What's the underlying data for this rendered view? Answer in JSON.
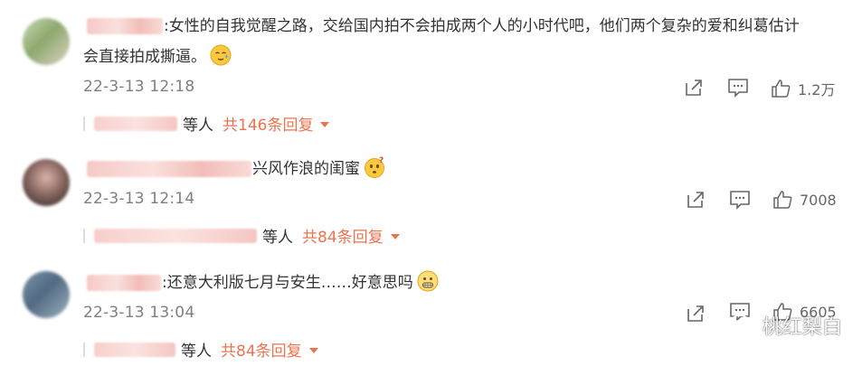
{
  "comments": [
    {
      "text_line1": ":女性的自我觉醒之路，交给国内拍不会拍成两个人的小时代吧，他们两个复杂的爱和纠葛估计",
      "text_line2": "会直接拍成撕逼。",
      "emoji": "sweat-smile-emoji",
      "time": "22-3-13 12:18",
      "like_count": "1.2万",
      "reply_deng": "等人",
      "reply_count": "共146条回复"
    },
    {
      "text_line1": "兴风作浪的闺蜜",
      "emoji": "thinking-emoji",
      "time": "22-3-13 12:14",
      "like_count": "7008",
      "reply_deng": "等人",
      "reply_count": "共84条回复"
    },
    {
      "text_line1": ":还意大利版七月与安生……好意思吗",
      "emoji": "grimace-emoji",
      "time": "22-3-13 13:04",
      "like_count": "6605",
      "reply_deng": "等人",
      "reply_count": "共84条回复"
    }
  ],
  "watermark": {
    "text": "桃红梨白"
  },
  "colors": {
    "accent": "#eb7350",
    "time": "#808080",
    "text": "#333333"
  }
}
